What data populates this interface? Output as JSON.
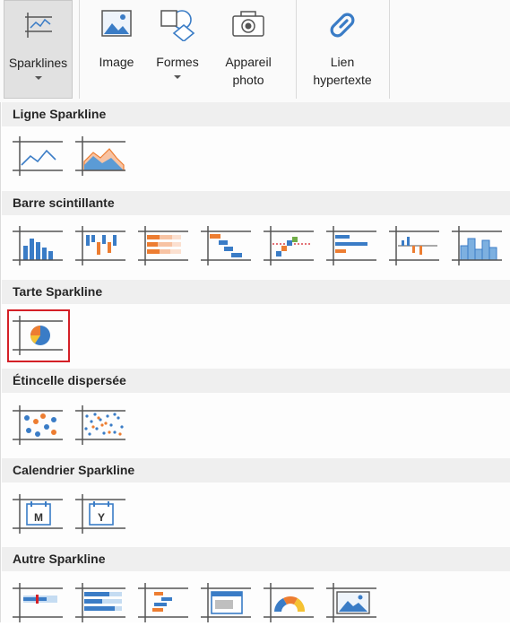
{
  "ribbon": {
    "sparklines": "Sparklines",
    "image": "Image",
    "formes": "Formes",
    "appareil_l1": "Appareil",
    "appareil_l2": "photo",
    "lien_l1": "Lien",
    "lien_l2": "hypertexte"
  },
  "gallery": {
    "ligne": "Ligne Sparkline",
    "barre": "Barre scintillante",
    "tarte": "Tarte Sparkline",
    "etincelle": "Étincelle dispersée",
    "calendrier": "Calendrier Sparkline",
    "autre": "Autre Sparkline",
    "cal_m": "M",
    "cal_y": "Y"
  },
  "colors": {
    "blue": "#3a7cc6",
    "orange": "#ed7d31",
    "red": "#d42027",
    "peach": "#f7c3a3"
  }
}
